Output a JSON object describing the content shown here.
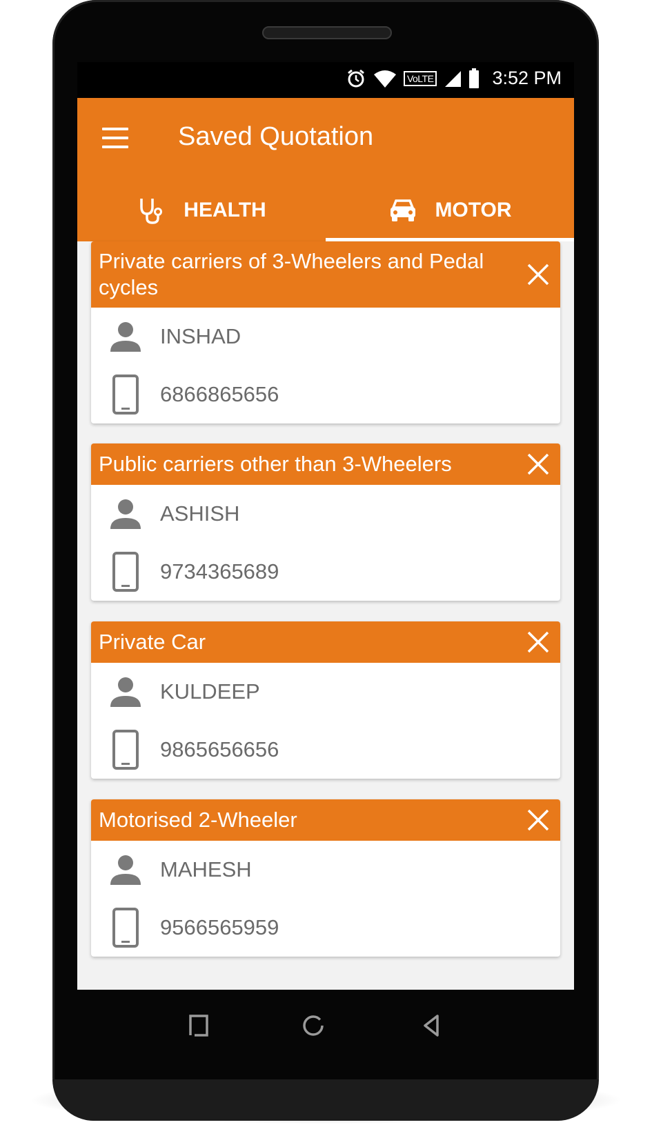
{
  "status_bar": {
    "time": "3:52 PM",
    "network_label": "VoLTE"
  },
  "app_bar": {
    "title": "Saved Quotation"
  },
  "tabs": [
    {
      "label": "HEALTH",
      "icon": "stethoscope-icon",
      "selected": false
    },
    {
      "label": "MOTOR",
      "icon": "car-icon",
      "selected": true
    }
  ],
  "quotations": [
    {
      "title": "Private carriers of 3-Wheelers and Pedal cycles",
      "name": "INSHAD",
      "phone": "6866865656"
    },
    {
      "title": "Public carriers other than 3-Wheelers",
      "name": "ASHISH",
      "phone": "9734365689"
    },
    {
      "title": "Private Car",
      "name": "KULDEEP",
      "phone": "9865656656"
    },
    {
      "title": "Motorised 2-Wheeler",
      "name": "MAHESH",
      "phone": "9566565959"
    }
  ],
  "colors": {
    "accent": "#E8791A",
    "text_secondary": "#6a6a6a",
    "icon_gray": "#7a7a7a"
  }
}
